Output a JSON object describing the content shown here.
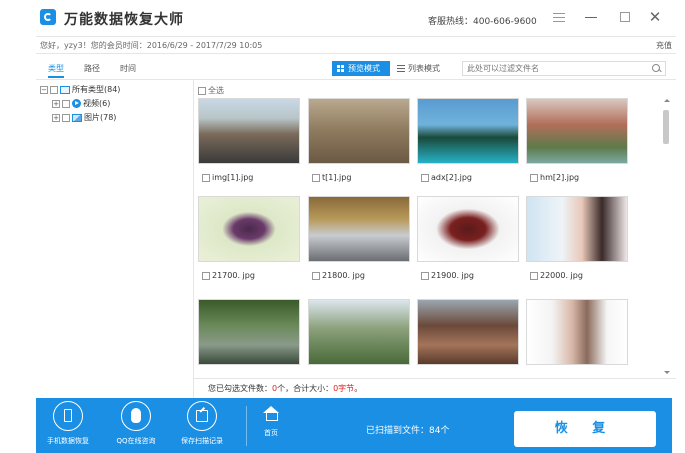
{
  "app": {
    "title": "万能数据恢复大师",
    "hotline": "客服热线：400-606-9600"
  },
  "member": {
    "info": "您好，yzy3！您的会员时间：2016/6/29 - 2017/7/29 10:05",
    "recharge": "充值"
  },
  "toolbar": {
    "tabs": [
      {
        "label": "类型",
        "active": true
      },
      {
        "label": "路径",
        "active": false
      },
      {
        "label": "时间",
        "active": false
      }
    ],
    "preview_mode": "预览模式",
    "list_mode": "列表模式",
    "filter_placeholder": "此处可以过滤文件名"
  },
  "tree": {
    "root": "所有类型(84)",
    "video": "视频(6)",
    "image": "图片(78)"
  },
  "grid": {
    "select_all": "全选",
    "files": [
      {
        "name": "img[1].jpg"
      },
      {
        "name": "t[1].jpg"
      },
      {
        "name": "adx[2].jpg"
      },
      {
        "name": "hm[2].jpg"
      },
      {
        "name": "21700. jpg"
      },
      {
        "name": "21800. jpg"
      },
      {
        "name": "21900. jpg"
      },
      {
        "name": "22000. jpg"
      },
      {
        "name": ""
      },
      {
        "name": ""
      },
      {
        "name": ""
      },
      {
        "name": ""
      }
    ]
  },
  "status": {
    "prefix": "您已勾选文件数：",
    "count": "0",
    "mid": "个，合计大小：",
    "size": "0字节",
    "suffix": "。"
  },
  "footer": {
    "phone_recover": "手机数据恢复",
    "qq_consult": "QQ在线咨询",
    "save_scan": "保存扫描记录",
    "home": "首页",
    "scanned": "已扫描到文件：84个",
    "recover": "恢 复"
  }
}
